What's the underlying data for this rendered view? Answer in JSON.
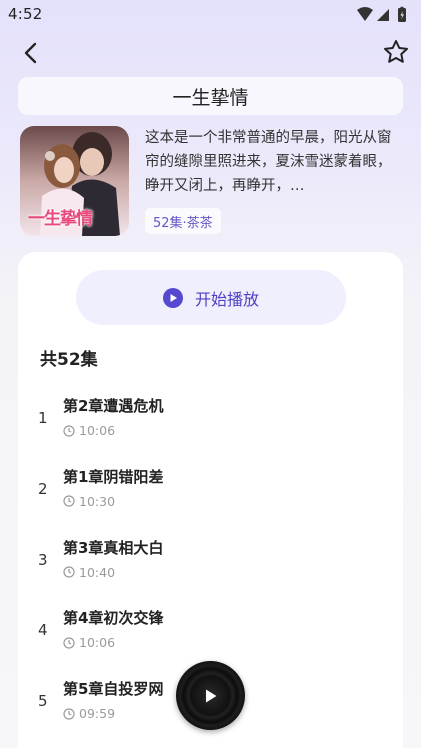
{
  "status_bar": {
    "time": "4:52"
  },
  "header": {
    "title": "一生挚情"
  },
  "book": {
    "cover_title": "一生挚情",
    "description": "这本是一个非常普通的早晨，阳光从窗帘的缝隙里照进来，夏沫雪迷蒙着眼，睁开又闭上，再睁开，…",
    "tag": "52集·茶茶"
  },
  "actions": {
    "play_all_label": "开始播放"
  },
  "episodes": {
    "count_label": "共52集",
    "items": [
      {
        "num": "1",
        "title": "第2章遭遇危机",
        "duration": "10:06"
      },
      {
        "num": "2",
        "title": "第1章阴错阳差",
        "duration": "10:30"
      },
      {
        "num": "3",
        "title": "第3章真相大白",
        "duration": "10:40"
      },
      {
        "num": "4",
        "title": "第4章初次交锋",
        "duration": "10:06"
      },
      {
        "num": "5",
        "title": "第5章自投罗网",
        "duration": "09:59"
      }
    ]
  },
  "colors": {
    "accent": "#5748d0",
    "background_top": "#e4e1fb"
  },
  "icons": {
    "back": "back-arrow-icon",
    "favorite": "star-outline-icon",
    "play": "play-icon",
    "clock": "clock-icon",
    "player": "vinyl-disc-icon"
  }
}
